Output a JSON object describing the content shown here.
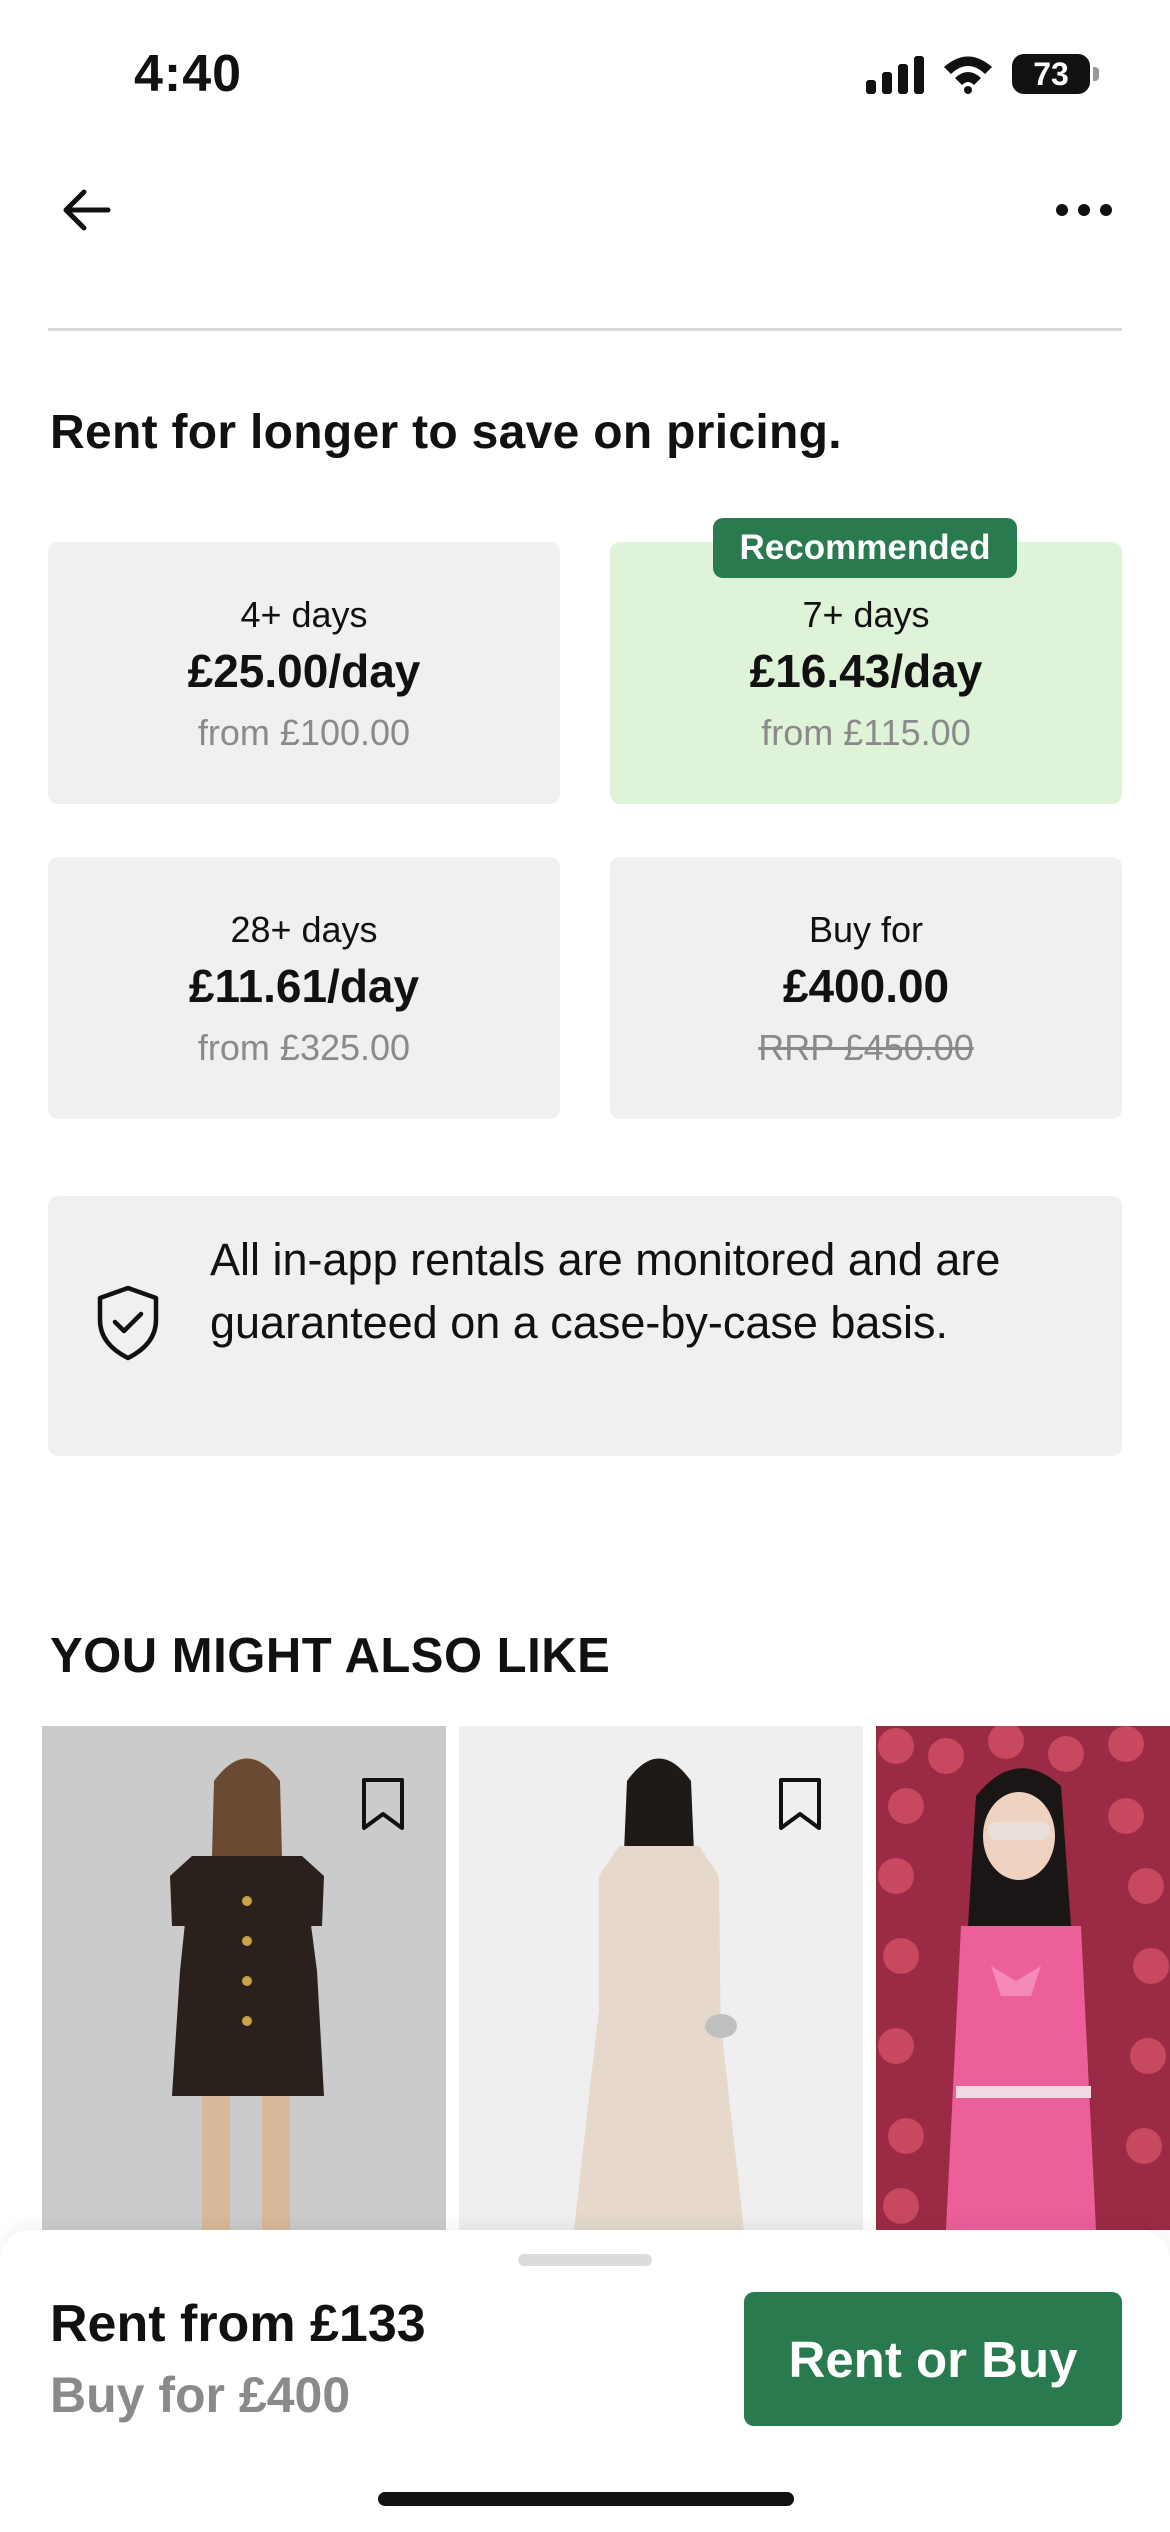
{
  "status_bar": {
    "time": "4:40",
    "battery": "73"
  },
  "nav": {
    "back_icon": "arrow-left-icon",
    "more_icon": "ellipsis-icon"
  },
  "pricing": {
    "headline": "Rent for longer to save on pricing.",
    "recommended_badge": "Recommended",
    "accent_color": "#2a7a4f",
    "recommended_bg": "#dff3d8",
    "options": [
      {
        "label": "4+ days",
        "price": "£25.00/day",
        "sub": "from £100.00"
      },
      {
        "label": "7+ days",
        "price": "£16.43/day",
        "sub": "from £115.00"
      },
      {
        "label": "28+ days",
        "price": "£11.61/day",
        "sub": "from £325.00"
      },
      {
        "label": "Buy for",
        "price": "£400.00",
        "sub": "RRP £450.00"
      }
    ]
  },
  "guarantee": {
    "icon": "shield-check-icon",
    "text": "All in-app rentals are monitored and are guaranteed on a case-by-case basis."
  },
  "recommendations": {
    "title": "YOU MIGHT ALSO LIKE",
    "bookmark_icon": "bookmark-icon"
  },
  "bottom_bar": {
    "rent_from": "Rent from £133",
    "buy_for": "Buy for £400",
    "cta_label": "Rent or Buy"
  }
}
